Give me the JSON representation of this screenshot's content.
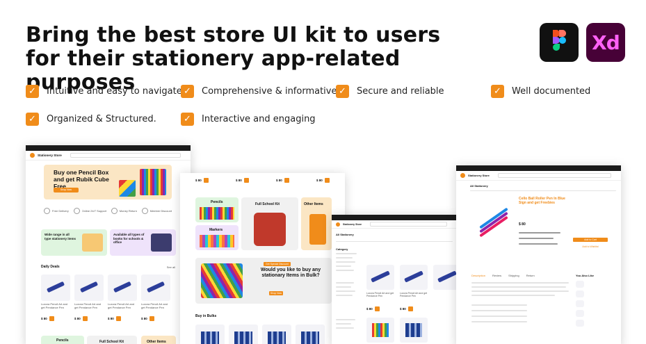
{
  "headline": "Bring the best store UI kit to users for their stationery app-related purposes",
  "badges": {
    "xd_label": "Xd",
    "figma_icon": "figma-logo-icon",
    "xd_icon": "adobe-xd-logo-icon"
  },
  "colors": {
    "accent": "#f08c1a",
    "xd_bg": "#470137",
    "xd_text": "#ff61f6",
    "dark": "#111111"
  },
  "check_glyph": "✓",
  "features": [
    "Intuitive and easy to navigate",
    "Comprehensive & informative",
    "Secure and reliable",
    "Well documented",
    "Organized & Structured.",
    "Interactive and engaging"
  ],
  "screen_home": {
    "store_name": "Stationery Store",
    "hero_title": "Buy one Pencil Box and get Rubik Cube Free",
    "hero_cta": "Shop Now",
    "service_items": [
      "Free Delivery",
      "Online 24/7 Support",
      "Money Return",
      "Member Discount"
    ],
    "promo_left": "Wide range in all type stationery items",
    "promo_right": "Available all types of books for schools & office",
    "section_title": "Daily Deals",
    "see_all": "See all",
    "product_name": "Luxora Pencil Art and get Pendance Pen",
    "price": "$ 80",
    "bottom_tiles": [
      "Pencils",
      "Full School Kit",
      "Other Items"
    ]
  },
  "screen_categories": {
    "price": "$ 80",
    "tiles": [
      "Pencils",
      "Full School Kit",
      "Other Items",
      "Markers"
    ],
    "bulk_title": "Would you like to buy any stationary Items in Bulk?",
    "bulk_tag": "Get Special Discount",
    "bulk_cta": "Shop Now",
    "section_title": "Buy in Bulks"
  },
  "screen_listing": {
    "store_name": "Stationery Store",
    "category_label": "All Stationery",
    "filter_title": "Category",
    "product_name": "Luxora Pencil Art and get Pendance Pen",
    "price": "$ 80"
  },
  "screen_product": {
    "store_name": "Stationery Store",
    "nav_label": "All Stationery",
    "product_title": "Cello Ball Roller Pen In Blue Sign and get Freebies",
    "price": "$ 80",
    "cta_buy": "Add to Cart",
    "cta_wish": "Add to Wishlist",
    "tabs": [
      "Description",
      "Review",
      "Shipping",
      "Return"
    ],
    "sidebar_title": "You Also Like"
  }
}
